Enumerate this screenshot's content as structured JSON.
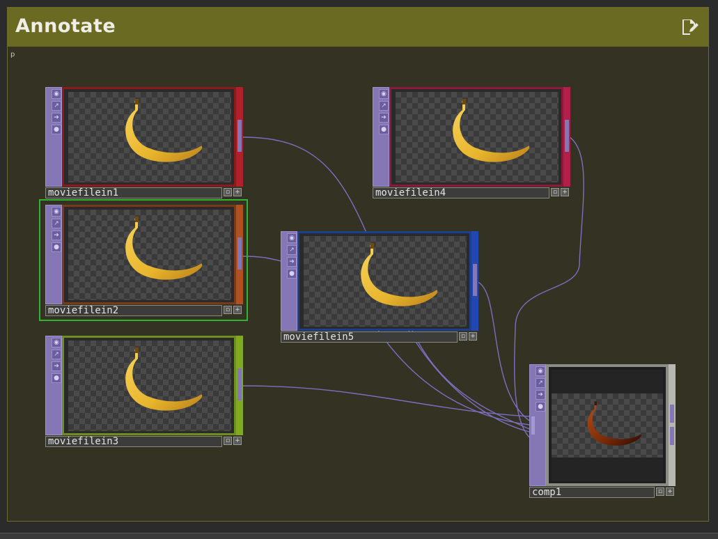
{
  "annotate": {
    "title": "Annotate",
    "corner_letter": "p",
    "edit_icon": "edit-note-icon",
    "colors": {
      "header": "#6b6a22",
      "background": "#343223"
    }
  },
  "nodes": {
    "n1": {
      "name": "moviefilein1",
      "border_color": "#8b1a1a"
    },
    "n2": {
      "name": "moviefilein2",
      "border_color": "#7a3a1a",
      "selected": true
    },
    "n3": {
      "name": "moviefilein3",
      "border_color": "#6c8f1f"
    },
    "n4": {
      "name": "moviefilein4",
      "border_color": "#8b1a3a"
    },
    "n5": {
      "name": "moviefilein5",
      "border_color": "#1d3f8f"
    },
    "comp": {
      "name": "comp1",
      "border_color": "#8d8d88"
    }
  },
  "strip_icons": [
    "viewer-toggle-icon",
    "bypass-icon",
    "display-icon",
    "lock-icon"
  ],
  "wire_color": "#7b6fc0"
}
